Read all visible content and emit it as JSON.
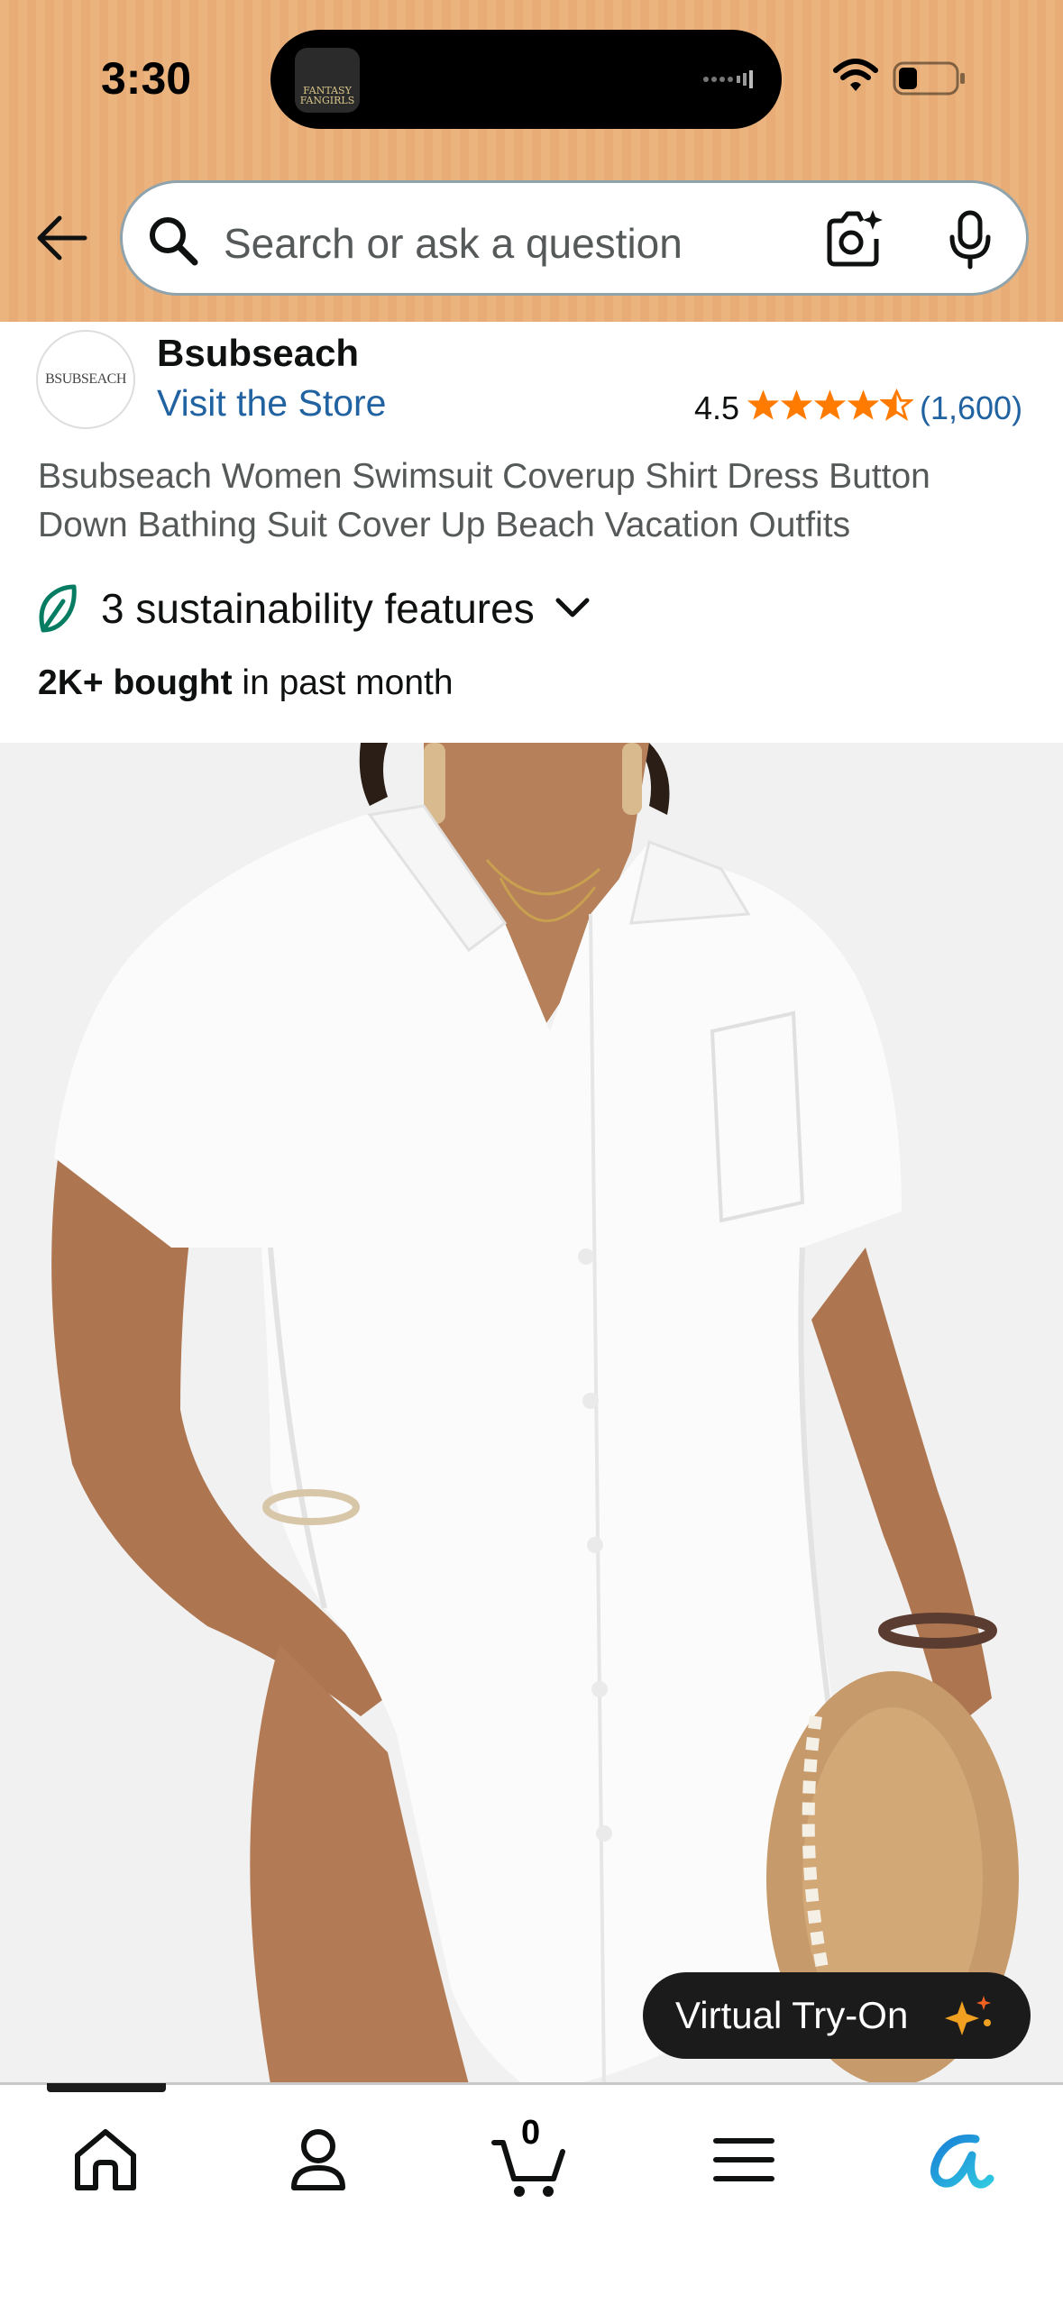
{
  "status_bar": {
    "time": "3:30",
    "island_app_label": "FANTASY FANGIRLS",
    "icons": [
      "wifi-icon",
      "battery-icon"
    ]
  },
  "header": {
    "back_icon": "back-arrow-icon",
    "search_placeholder": "Search or ask a question",
    "icons": [
      "search-icon",
      "camera-icon",
      "mic-icon"
    ],
    "background_color": "#ebb47f"
  },
  "brand": {
    "logo_text": "BSUBSEACH",
    "name": "Bsubseach",
    "visit_store": "Visit the Store",
    "rating": "4.5",
    "star_rating": 4.5,
    "rating_count": "(1,600)"
  },
  "product": {
    "title": "Bsubseach Women Swimsuit Coverup Shirt Dress Button Down Bathing Suit Cover Up Beach Vacation Outfits",
    "sustainability": "3 sustainability features",
    "bought_bold": "2K+ bought",
    "bought_rest": " in past month",
    "try_on_label": "Virtual Try-On"
  },
  "bottom_nav": {
    "items": [
      "home-icon",
      "account-icon",
      "cart-icon",
      "menu-icon",
      "rufus-icon"
    ],
    "cart_count": "0"
  },
  "colors": {
    "link": "#2162a1",
    "star": "#ff7b00",
    "leaf": "#067d62"
  }
}
